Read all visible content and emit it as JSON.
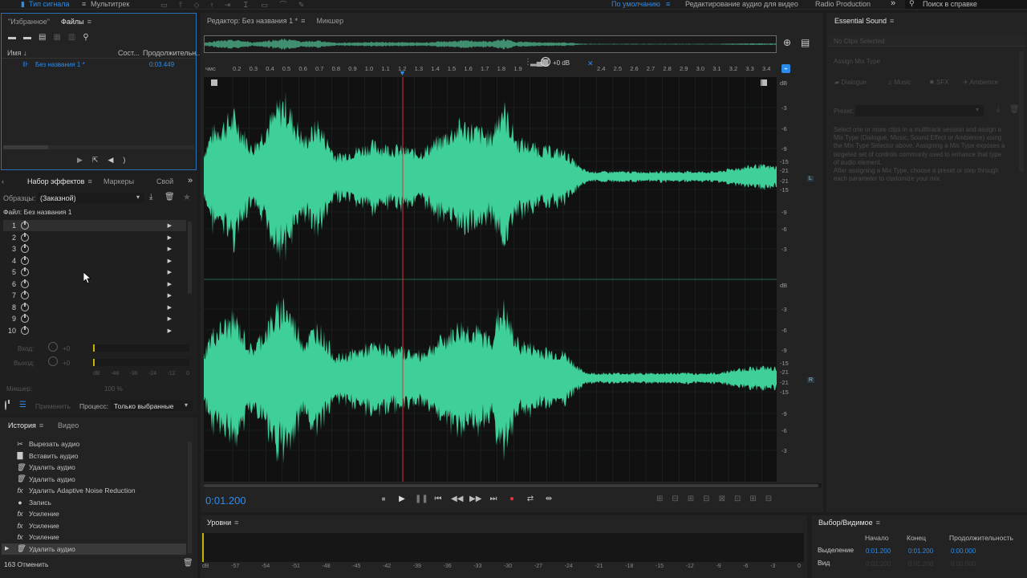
{
  "top_bar": {
    "signal_type": "Тип сигнала",
    "multitrack": "Мультитрек",
    "workspace_default": "По умолчанию",
    "workspace_video": "Редактирование аудио для видео",
    "workspace_radio": "Radio Production",
    "more_glyph": "»",
    "search_placeholder": "Поиск в справке"
  },
  "files_panel": {
    "tab_favorites": "\"Избранное\"",
    "tab_files": "Файлы",
    "col_name": "Имя",
    "col_status": "Сост...",
    "col_duration": "Продолжительн...",
    "file_name": "Без названия 1 *",
    "file_duration": "0:03.449"
  },
  "effects_panel": {
    "tab_effects": "Набор эффектов",
    "tab_markers": "Маркеры",
    "tab_custom": "Свой",
    "presets_label": "Образцы:",
    "presets_value": "(Заказной)",
    "file_label": "Файл: Без названия 1",
    "slots": [
      "1",
      "2",
      "3",
      "4",
      "5",
      "6",
      "7",
      "8",
      "9",
      "10"
    ],
    "input_label": "Вход:",
    "output_label": "Выход:",
    "input_val": "+0",
    "output_val": "+0",
    "meter_scale": [
      "dB",
      "-48",
      "-36",
      "-24",
      "-12",
      "0"
    ],
    "mix_label": "Микшер:",
    "mix_value": "100 %",
    "apply_button": "Применить",
    "process_label": "Процесс:",
    "process_value": "Только выбранные"
  },
  "history_panel": {
    "tab_history": "История",
    "tab_video": "Видео",
    "items": [
      {
        "icon": "✂",
        "label": "Вырезать аудио"
      },
      {
        "icon": "▇",
        "label": "Вставить аудио"
      },
      {
        "icon": "🗑",
        "label": "Удалить аудио"
      },
      {
        "icon": "🗑",
        "label": "Удалить аудио"
      },
      {
        "icon": "fx",
        "label": "Удалить Adaptive Noise Reduction"
      },
      {
        "icon": "●",
        "label": "Запись"
      },
      {
        "icon": "fx",
        "label": "Усиление"
      },
      {
        "icon": "fx",
        "label": "Усиление"
      },
      {
        "icon": "fx",
        "label": "Усиление"
      },
      {
        "icon": "🗑",
        "label": "Удалить аудио"
      }
    ],
    "footer": "163 Отменить"
  },
  "editor": {
    "tab_editor": "Редактор: Без названия 1 *",
    "tab_mixer": "Микшер",
    "ruler_unit": "чмс",
    "ruler_ticks": [
      "0.2",
      "0.3",
      "0.4",
      "0.5",
      "0.6",
      "0.7",
      "0.8",
      "0.9",
      "1.0",
      "1.1",
      "1.2",
      "1.3",
      "1.4",
      "1.5",
      "1.6",
      "1.7",
      "1.8",
      "1.9",
      "2.4",
      "2.5",
      "2.6",
      "2.7",
      "2.8",
      "2.9",
      "3.0",
      "3.1",
      "3.2",
      "3.3",
      "3.4"
    ],
    "hud_db": "+0 dB",
    "db_scale": [
      "dB",
      "-3",
      "-6",
      "-9",
      "-15",
      "-21",
      "-21",
      "-15",
      "-9",
      "-6",
      "-3"
    ],
    "channel_left": "L",
    "channel_right": "R",
    "current_time": "0:01.200"
  },
  "essential_sound": {
    "title": "Essential Sound",
    "no_clip": "No Clips Selected",
    "assign_mix": "Assign Mix Type",
    "types": [
      "Dialogue",
      "Music",
      "SFX",
      "Ambience"
    ],
    "preset_label": "Preset:",
    "help_text": [
      "Select one or more clips in a multitrack session and assign a",
      "Mix Type (Dialogue, Music, Sound Effect or Ambience) using",
      "the Mix Type Selector above. Assigning a Mix Type exposes a",
      "targeted set of controls commonly used to enhance that type",
      "of audio element.",
      "After assigning a Mix Type, choose a preset or step through",
      "each parameter to customize your mix."
    ]
  },
  "levels_panel": {
    "title": "Уровни",
    "scale": [
      "dB",
      "-57",
      "-54",
      "-51",
      "-48",
      "-45",
      "-42",
      "-39",
      "-36",
      "-33",
      "-30",
      "-27",
      "-24",
      "-21",
      "-18",
      "-15",
      "-12",
      "-9",
      "-6",
      "-3",
      "0"
    ]
  },
  "selection_panel": {
    "title": "Выбор/Видимое",
    "col_start": "Начало",
    "col_end": "Конец",
    "col_duration": "Продолжительность",
    "row_selection": "Выделение",
    "row_view": "Вид",
    "sel_start": "0:01.200",
    "sel_end": "0:01.200",
    "sel_duration": "0:00.000"
  },
  "colors": {
    "accent": "#2d8ceb",
    "waveform": "#3fcf99",
    "playhead": "#e03030",
    "record": "#e5323a"
  }
}
